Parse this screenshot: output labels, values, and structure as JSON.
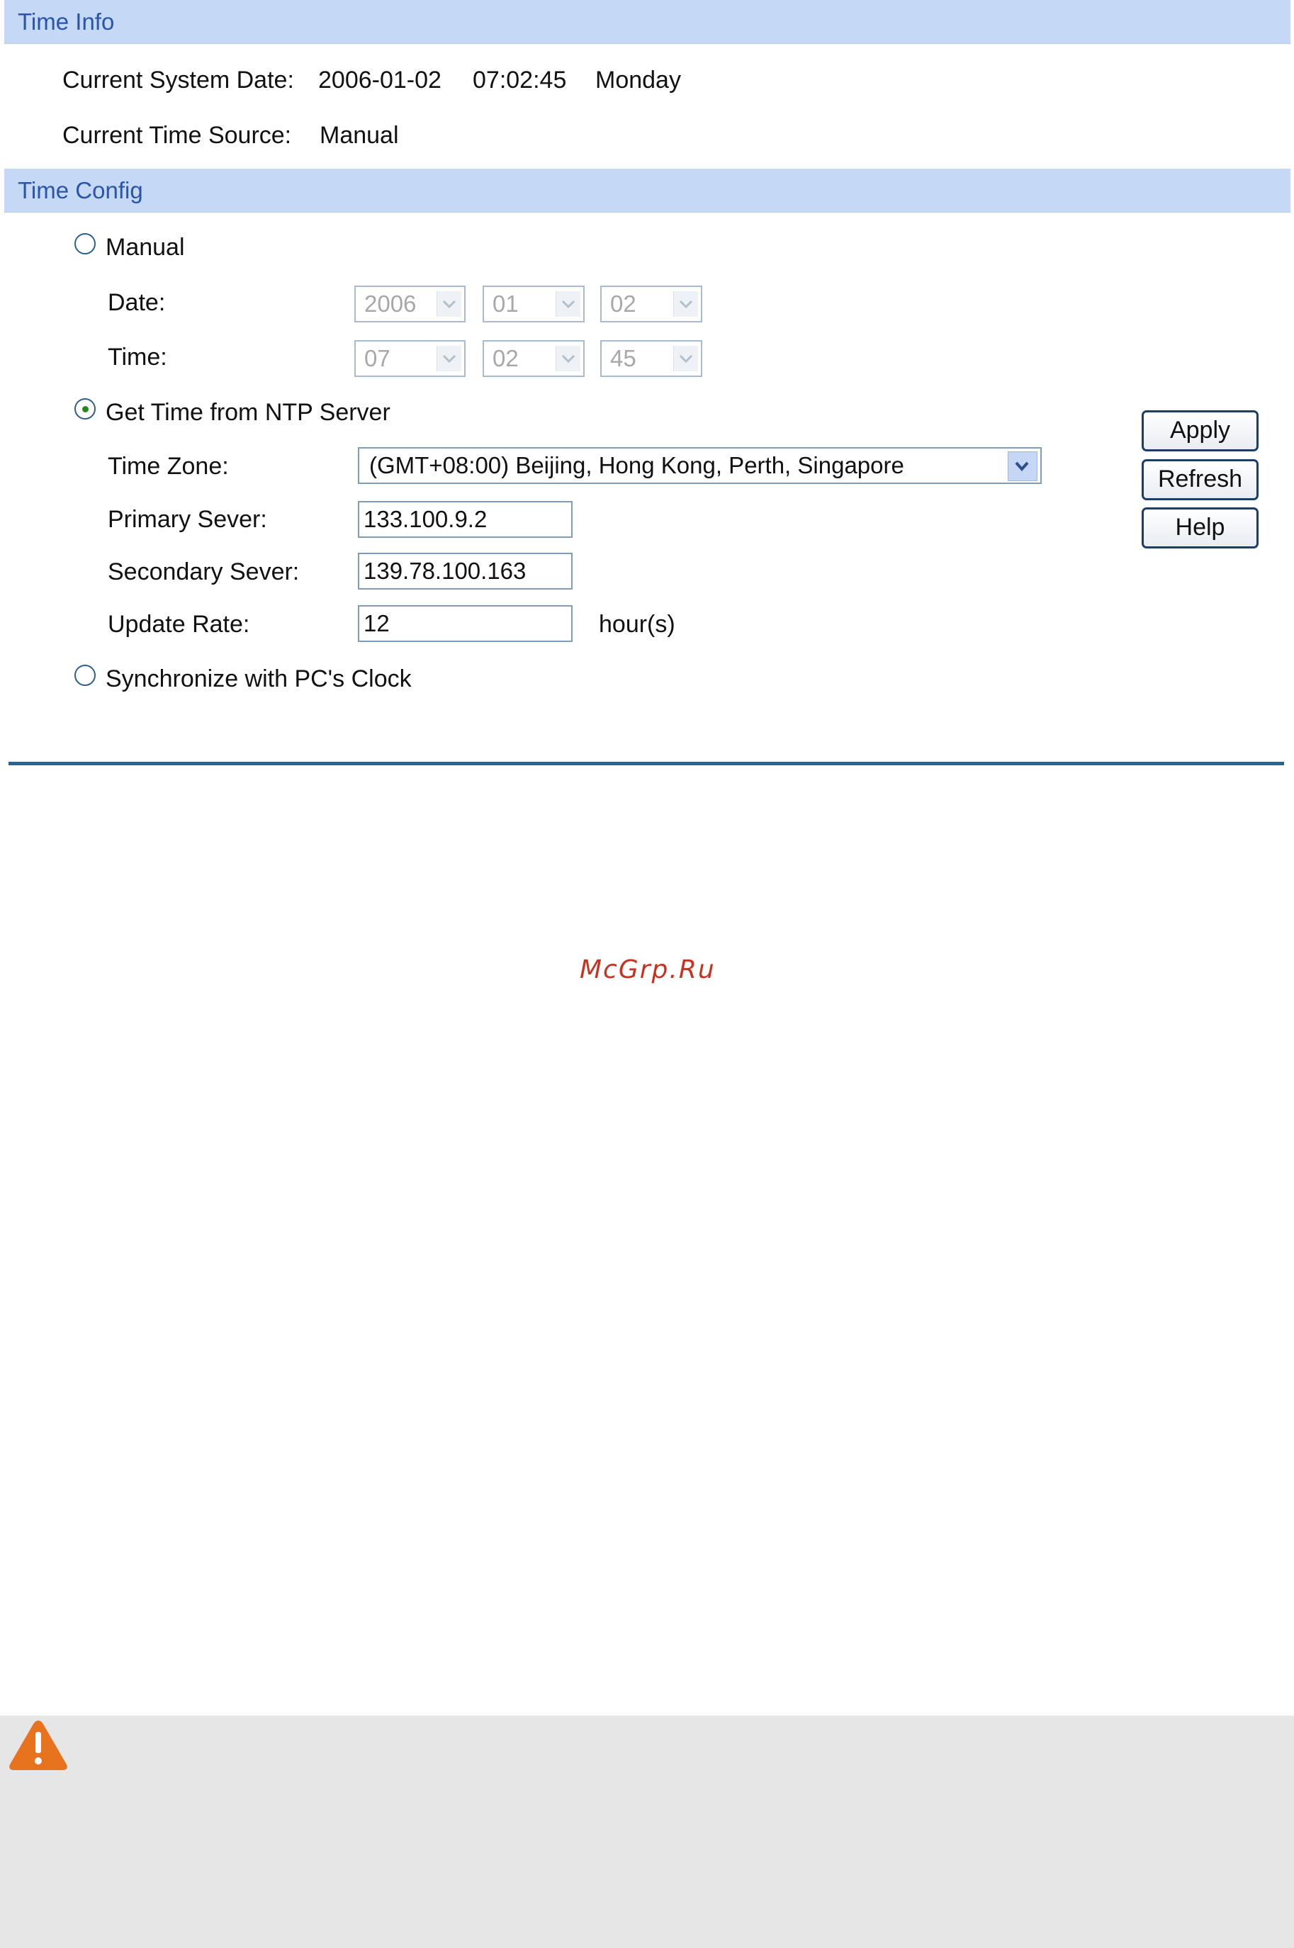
{
  "time_info": {
    "header": "Time Info",
    "current_date_label": "Current System Date:",
    "current_date": "2006-01-02",
    "current_time": "07:02:45",
    "current_weekday": "Monday",
    "source_label": "Current Time Source:",
    "source_value": "Manual"
  },
  "time_config": {
    "header": "Time Config",
    "manual": {
      "label": "Manual",
      "selected": false,
      "date_label": "Date:",
      "date": {
        "year": "2006",
        "month": "01",
        "day": "02"
      },
      "time_label": "Time:",
      "time": {
        "hour": "07",
        "minute": "02",
        "second": "45"
      }
    },
    "ntp": {
      "label": "Get Time from NTP Server",
      "selected": true,
      "timezone_label": "Time Zone:",
      "timezone_value": "(GMT+08:00) Beijing, Hong Kong, Perth, Singapore",
      "primary_label": "Primary Sever:",
      "primary_value": "133.100.9.2",
      "secondary_label": "Secondary Sever:",
      "secondary_value": "139.78.100.163",
      "update_rate_label": "Update Rate:",
      "update_rate_value": "12",
      "update_rate_unit": "hour(s)"
    },
    "pc_sync": {
      "label": "Synchronize with PC's Clock",
      "selected": false
    }
  },
  "buttons": {
    "apply": "Apply",
    "refresh": "Refresh",
    "help": "Help"
  },
  "watermark": "McGrp.Ru",
  "icons": {
    "warning": "warning-icon"
  },
  "colors": {
    "header_bg": "#c5d9f6",
    "header_text": "#2b55a8",
    "rule": "#2a6491",
    "warning": "#e8731f",
    "watermark": "#c8321e",
    "note_bg": "#e6e6e6"
  }
}
